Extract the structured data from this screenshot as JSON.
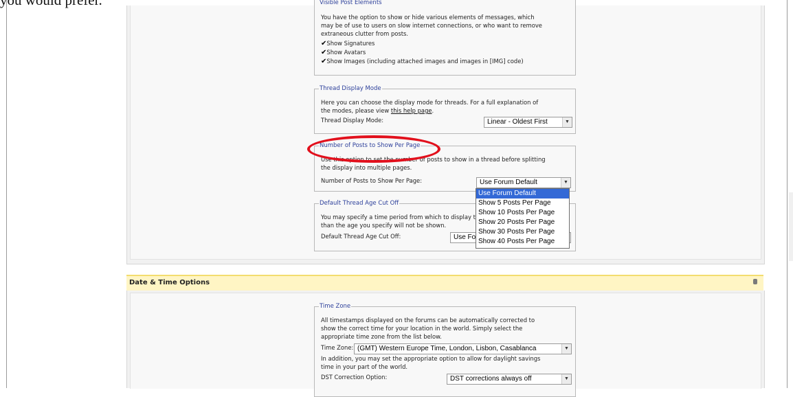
{
  "doc_text": "you would prefer.",
  "visible_post": {
    "legend": "Visible Post Elements",
    "lines": [
      "You have the option to show or hide various elements of messages, which",
      "may be of use to users on slow internet connections, or who want to remove",
      "extraneous clutter from posts."
    ],
    "checkboxes": [
      {
        "label": "Show Signatures",
        "checked": true
      },
      {
        "label": "Show Avatars",
        "checked": true
      },
      {
        "label": "Show Images (including attached images and images in [IMG] code)",
        "checked": true
      }
    ]
  },
  "thread_display": {
    "legend": "Thread Display Mode",
    "line1": "Here you can choose the display mode for threads. For a full explanation of",
    "line2_prefix": "the modes, please view ",
    "line2_link": "this help page",
    "line2_suffix": ".",
    "label": "Thread Display Mode:",
    "value": "Linear - Oldest First"
  },
  "posts_per_page": {
    "legend": "Number of Posts to Show Per Page",
    "line1": "Use this option to set the number of posts to show in a thread before splitting",
    "line2": "the display into multiple pages.",
    "label": "Number of Posts to Show Per Page:",
    "value": "Use Forum Default",
    "options": [
      "Use Forum Default",
      "Show 5 Posts Per Page",
      "Show 10 Posts Per Page",
      "Show 20 Posts Per Page",
      "Show 30 Posts Per Page",
      "Show 40 Posts Per Page"
    ],
    "selected_option": "Use Forum Default"
  },
  "thread_age": {
    "legend": "Default Thread Age Cut Off",
    "line1": "You may specify a time period from which to display threads. Threads older",
    "line2": "than the age you specify will not be shown.",
    "label": "Default Thread Age Cut Off:",
    "value": "Use Forum Default"
  },
  "date_time": {
    "section_title": "Date & Time Options",
    "tz_legend": "Time Zone",
    "tz_lines": [
      "All timestamps displayed on the forums can be automatically corrected to",
      "show the correct time for your location in the world. Simply select the",
      "appropriate time zone from the list below."
    ],
    "tz_label": "Time Zone:",
    "tz_value": "(GMT) Western Europe Time, London, Lisbon, Casablanca",
    "dst_lines": [
      "In addition, you may set the appropriate option to allow for daylight savings",
      "time in your part of the world."
    ],
    "dst_label": "DST Correction Option:",
    "dst_value": "DST corrections always off"
  },
  "colors": {
    "legend_blue": "#2c3f9a",
    "highlight_red": "#e2101c",
    "section_yellow": "#fff5c4",
    "selected_blue": "#3369d6"
  }
}
